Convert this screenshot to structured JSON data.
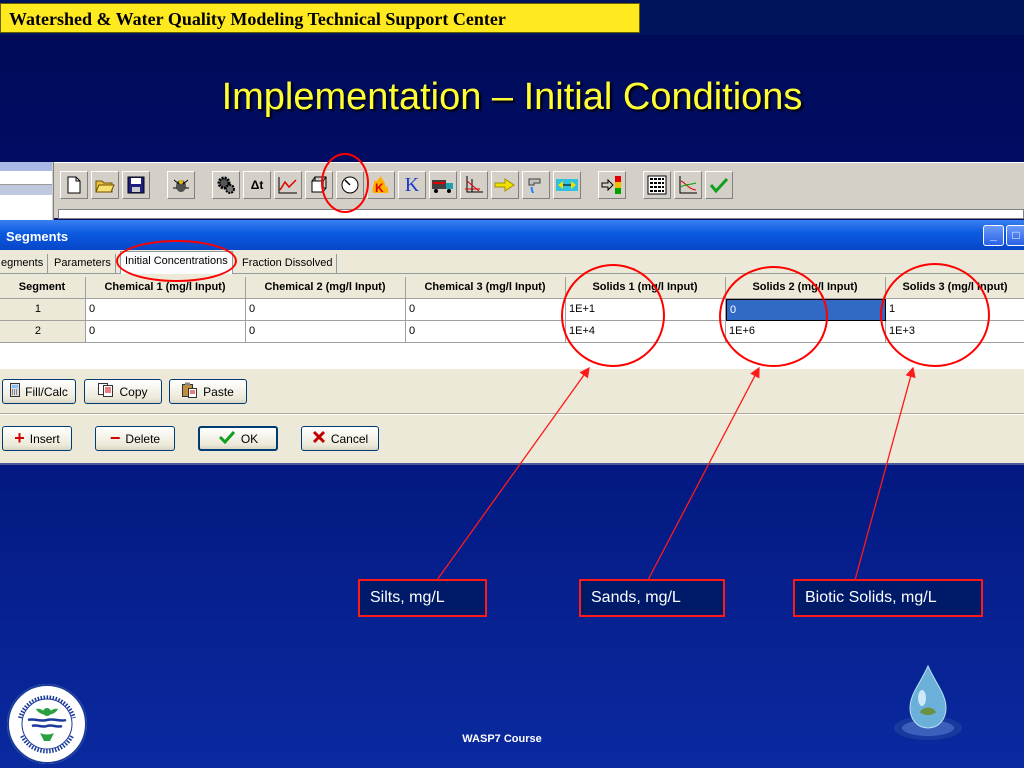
{
  "header": {
    "title": "Watershed & Water Quality Modeling Technical Support Center"
  },
  "slide": {
    "title": "Implementation – Initial Conditions",
    "footer": "WASP7 Course"
  },
  "toolbar": {
    "buttons": [
      {
        "icon": "new-file-icon"
      },
      {
        "icon": "open-folder-icon"
      },
      {
        "icon": "save-icon"
      },
      {
        "icon": "bug-icon"
      },
      {
        "icon": "gear-icon"
      },
      {
        "icon": "delta-t-icon",
        "label": "Δt"
      },
      {
        "icon": "line-chart-icon"
      },
      {
        "icon": "cube-icon"
      },
      {
        "icon": "clock-icon"
      },
      {
        "icon": "k-fire-icon"
      },
      {
        "icon": "k-icon",
        "label": "K"
      },
      {
        "icon": "truck-icon"
      },
      {
        "icon": "axis-chart-icon"
      },
      {
        "icon": "arrow-icon"
      },
      {
        "icon": "faucet-icon"
      },
      {
        "icon": "exchange-icon"
      },
      {
        "icon": "signal-icon"
      },
      {
        "icon": "parameter-table-icon"
      },
      {
        "icon": "graph-icon"
      },
      {
        "icon": "checkmark-icon"
      }
    ]
  },
  "dialog": {
    "title": "Segments",
    "tabs": [
      "egments",
      "Parameters",
      "Initial Concentrations",
      "Fraction Dissolved"
    ],
    "active_tab": "Initial Concentrations",
    "columns": [
      "Segment",
      "Chemical 1 (mg/l Input)",
      "Chemical 2 (mg/l Input)",
      "Chemical 3 (mg/l Input)",
      "Solids 1 (mg/l Input)",
      "Solids 2 (mg/l Input)",
      "Solids 3 (mg/l Input)"
    ],
    "rows": [
      [
        "1",
        "0",
        "0",
        "0",
        "1E+1",
        "0",
        "1"
      ],
      [
        "2",
        "0",
        "0",
        "0",
        "1E+4",
        "1E+6",
        "1E+3"
      ]
    ],
    "buttons": {
      "fill_calc": "Fill/Calc",
      "copy": "Copy",
      "paste": "Paste",
      "insert": "Insert",
      "delete": "Delete",
      "ok": "OK",
      "cancel": "Cancel"
    }
  },
  "callouts": {
    "silts": "Silts, mg/L",
    "sands": "Sands, mg/L",
    "biotic": "Biotic Solids, mg/L"
  },
  "colors": {
    "header_yellow": "#ffea1f",
    "title_yellow": "#ffff33",
    "annotation_red": "#ff0000",
    "background_blue": "#001070"
  }
}
